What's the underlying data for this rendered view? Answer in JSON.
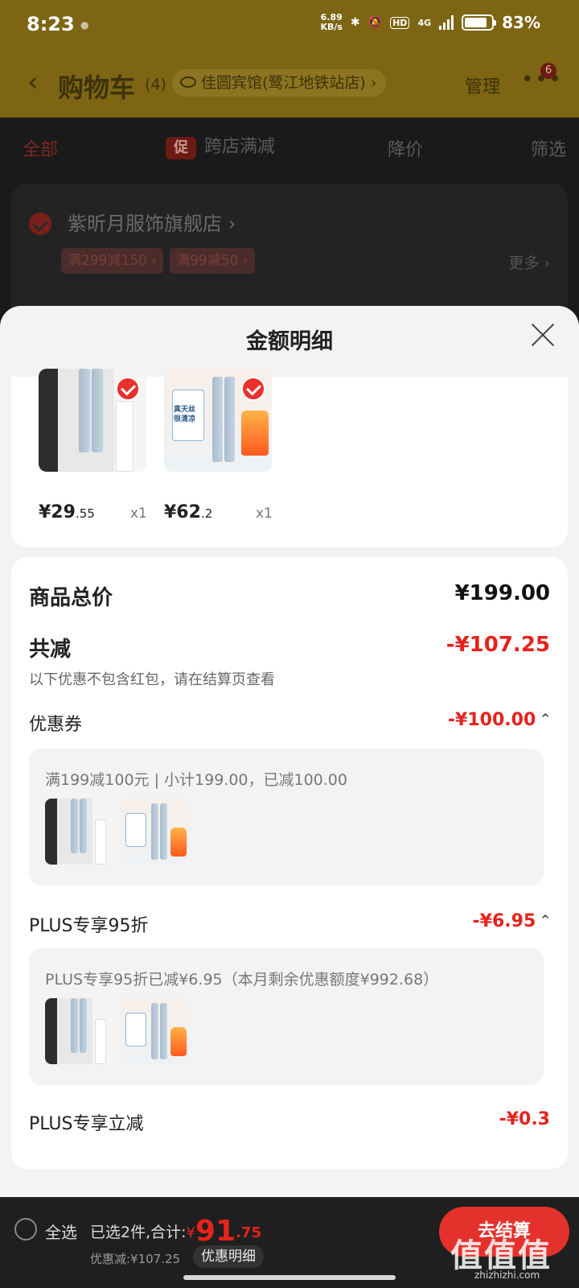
{
  "status": {
    "time": "8:23",
    "net_speed": "6.89",
    "net_unit": "KB/s",
    "network": "4G",
    "battery": "83%",
    "battery_level": 0.83
  },
  "header": {
    "back": "‹",
    "title": "购物车",
    "count": "(4)",
    "address": "佳圆宾馆(鹭江地铁站店)",
    "address_chevron": "›",
    "manage": "管理",
    "more": "•••",
    "badge": "6"
  },
  "tabs": {
    "all": "全部",
    "promo_tag": "促",
    "cross_shop": "跨店满减",
    "price_drop": "降价",
    "filter": "筛选"
  },
  "shop": {
    "name": "紫昕月服饰旗舰店 ›",
    "promos": [
      "满299减150 ›",
      "满99减50 ›"
    ],
    "more": "更多 ›"
  },
  "sheet": {
    "title": "金额明细",
    "products": [
      {
        "price_int": "¥29",
        "price_dec": ".55",
        "qty": "x1"
      },
      {
        "price_int": "¥62",
        "price_dec": ".2",
        "qty": "x1"
      }
    ],
    "product_b_text": {
      "l1": "真天丝",
      "l2": "很清凉"
    },
    "total_label": "商品总价",
    "total_value": "¥199.00",
    "reduce_label": "共减",
    "reduce_value": "-¥107.25",
    "reduce_note": "以下优惠不包含红包，请在结算页查看",
    "coupon_label": "优惠券",
    "coupon_value": "-¥100.00",
    "coupon_detail": "满199减100元 | 小计199.00，已减100.00",
    "plus95_label": "PLUS专享95折",
    "plus95_value": "-¥6.95",
    "plus95_detail": "PLUS专享95折已减¥6.95（本月剩余优惠额度¥992.68）",
    "plus_instant_label": "PLUS专享立减",
    "plus_instant_value": "-¥0.3",
    "caret": "^"
  },
  "bottom": {
    "select_all": "全选",
    "selected": "已选2件,合计:",
    "cur": "¥",
    "total_int": "91",
    "total_dec": ".75",
    "discount": "优惠减:¥107.25",
    "detail_link": "优惠明细",
    "checkout": "去结算",
    "watermark": "值值值",
    "watermark_url": "zhizhizhi.com"
  }
}
